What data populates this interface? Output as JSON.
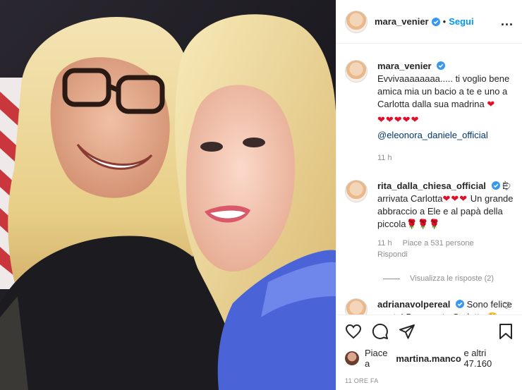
{
  "post": {
    "username": "mara_venier",
    "follow_label": "Segui",
    "separator": "•",
    "more_label": "...",
    "caption_text": "Evvivaaaaaaaa..... ti voglio bene amica mia un bacio a te e uno a Carlotta dalla sua madrina",
    "caption_heart": "❤",
    "caption_hearts": "❤❤❤❤❤",
    "caption_mention": "@eleonora_daniele_official",
    "caption_time": "11 h"
  },
  "comments": [
    {
      "username": "rita_dalla_chiesa_official",
      "text": "È arrivata Carlotta",
      "hearts": "❤❤❤",
      "text2": "Un grande abbraccio a Ele e al papà della piccola",
      "roses": "🌹🌹🌹",
      "time": "11 h",
      "likes": "Piace a 531 persone",
      "reply": "Rispondi",
      "view_replies": "Visualizza le risposte (2)"
    },
    {
      "username": "adrianavolpereal",
      "text": "Sono felice per te! Benvenuta Carlotta",
      "emoji": "😍"
    }
  ],
  "actions": {
    "icons": [
      "heart-icon",
      "comment-icon",
      "share-icon",
      "bookmark-icon"
    ],
    "likes_prefix": "Piace a",
    "likes_user": "martina.manco",
    "likes_suffix": "e altri 47.160",
    "time": "11 ORE FA"
  },
  "colors": {
    "link": "#0095f6",
    "verified": "#3897f0",
    "muted": "#8e8e8e",
    "heart": "#e0102b"
  }
}
